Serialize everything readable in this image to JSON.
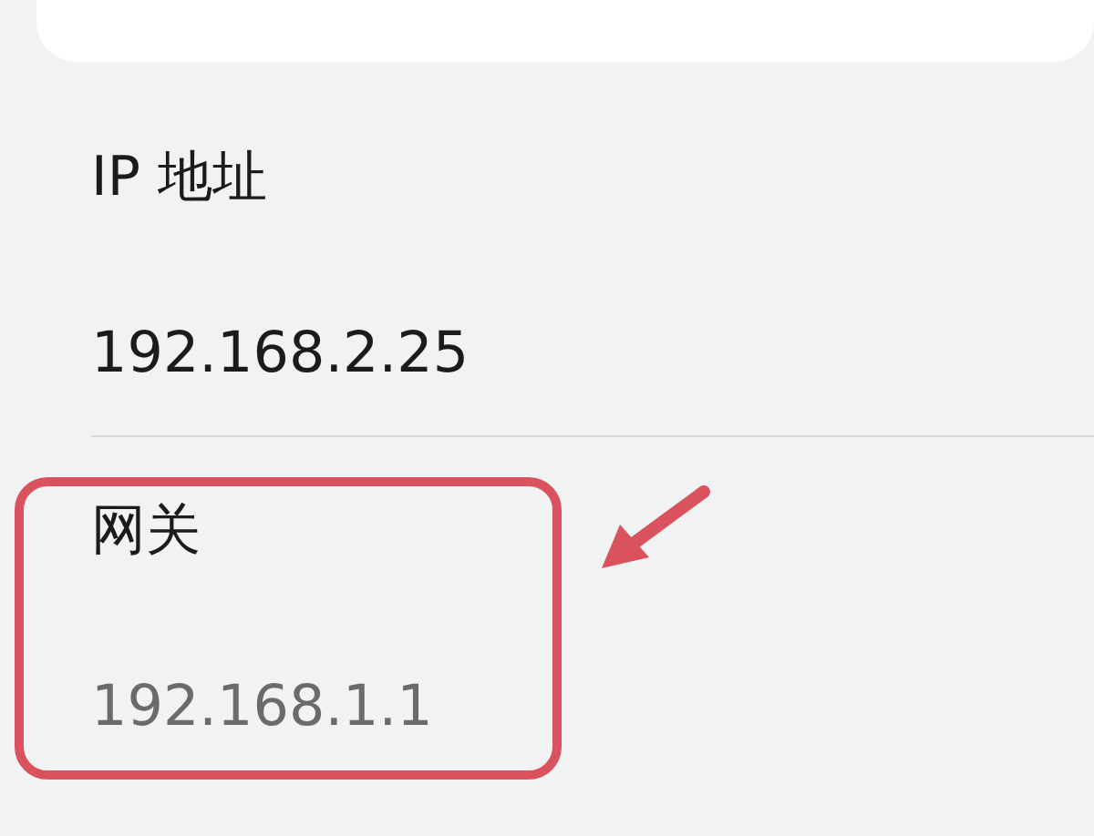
{
  "fields": [
    {
      "label": "IP 地址",
      "value": "192.168.2.25",
      "highlighted": false
    },
    {
      "label": "网关",
      "value": "192.168.1.1",
      "highlighted": true
    }
  ]
}
